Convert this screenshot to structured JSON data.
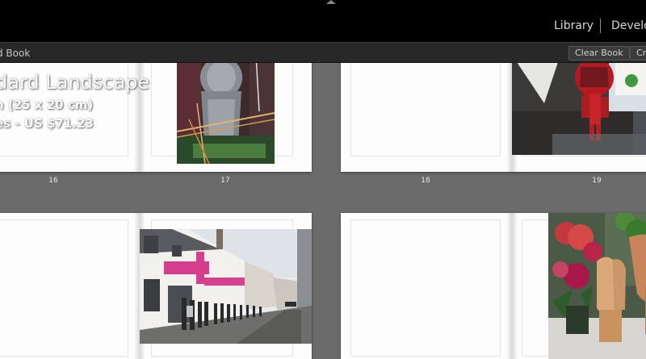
{
  "modules": {
    "library": "Library",
    "develop": "Develo"
  },
  "toolbar": {
    "title": "d Book",
    "clear_book": "Clear Book",
    "create": "Cr"
  },
  "cover_text": {
    "line1": "dard Landscape",
    "line2": "n (25 x 20 cm)",
    "line3": "es - US $71.23"
  },
  "pages": [
    "16",
    "17",
    "18",
    "19"
  ]
}
